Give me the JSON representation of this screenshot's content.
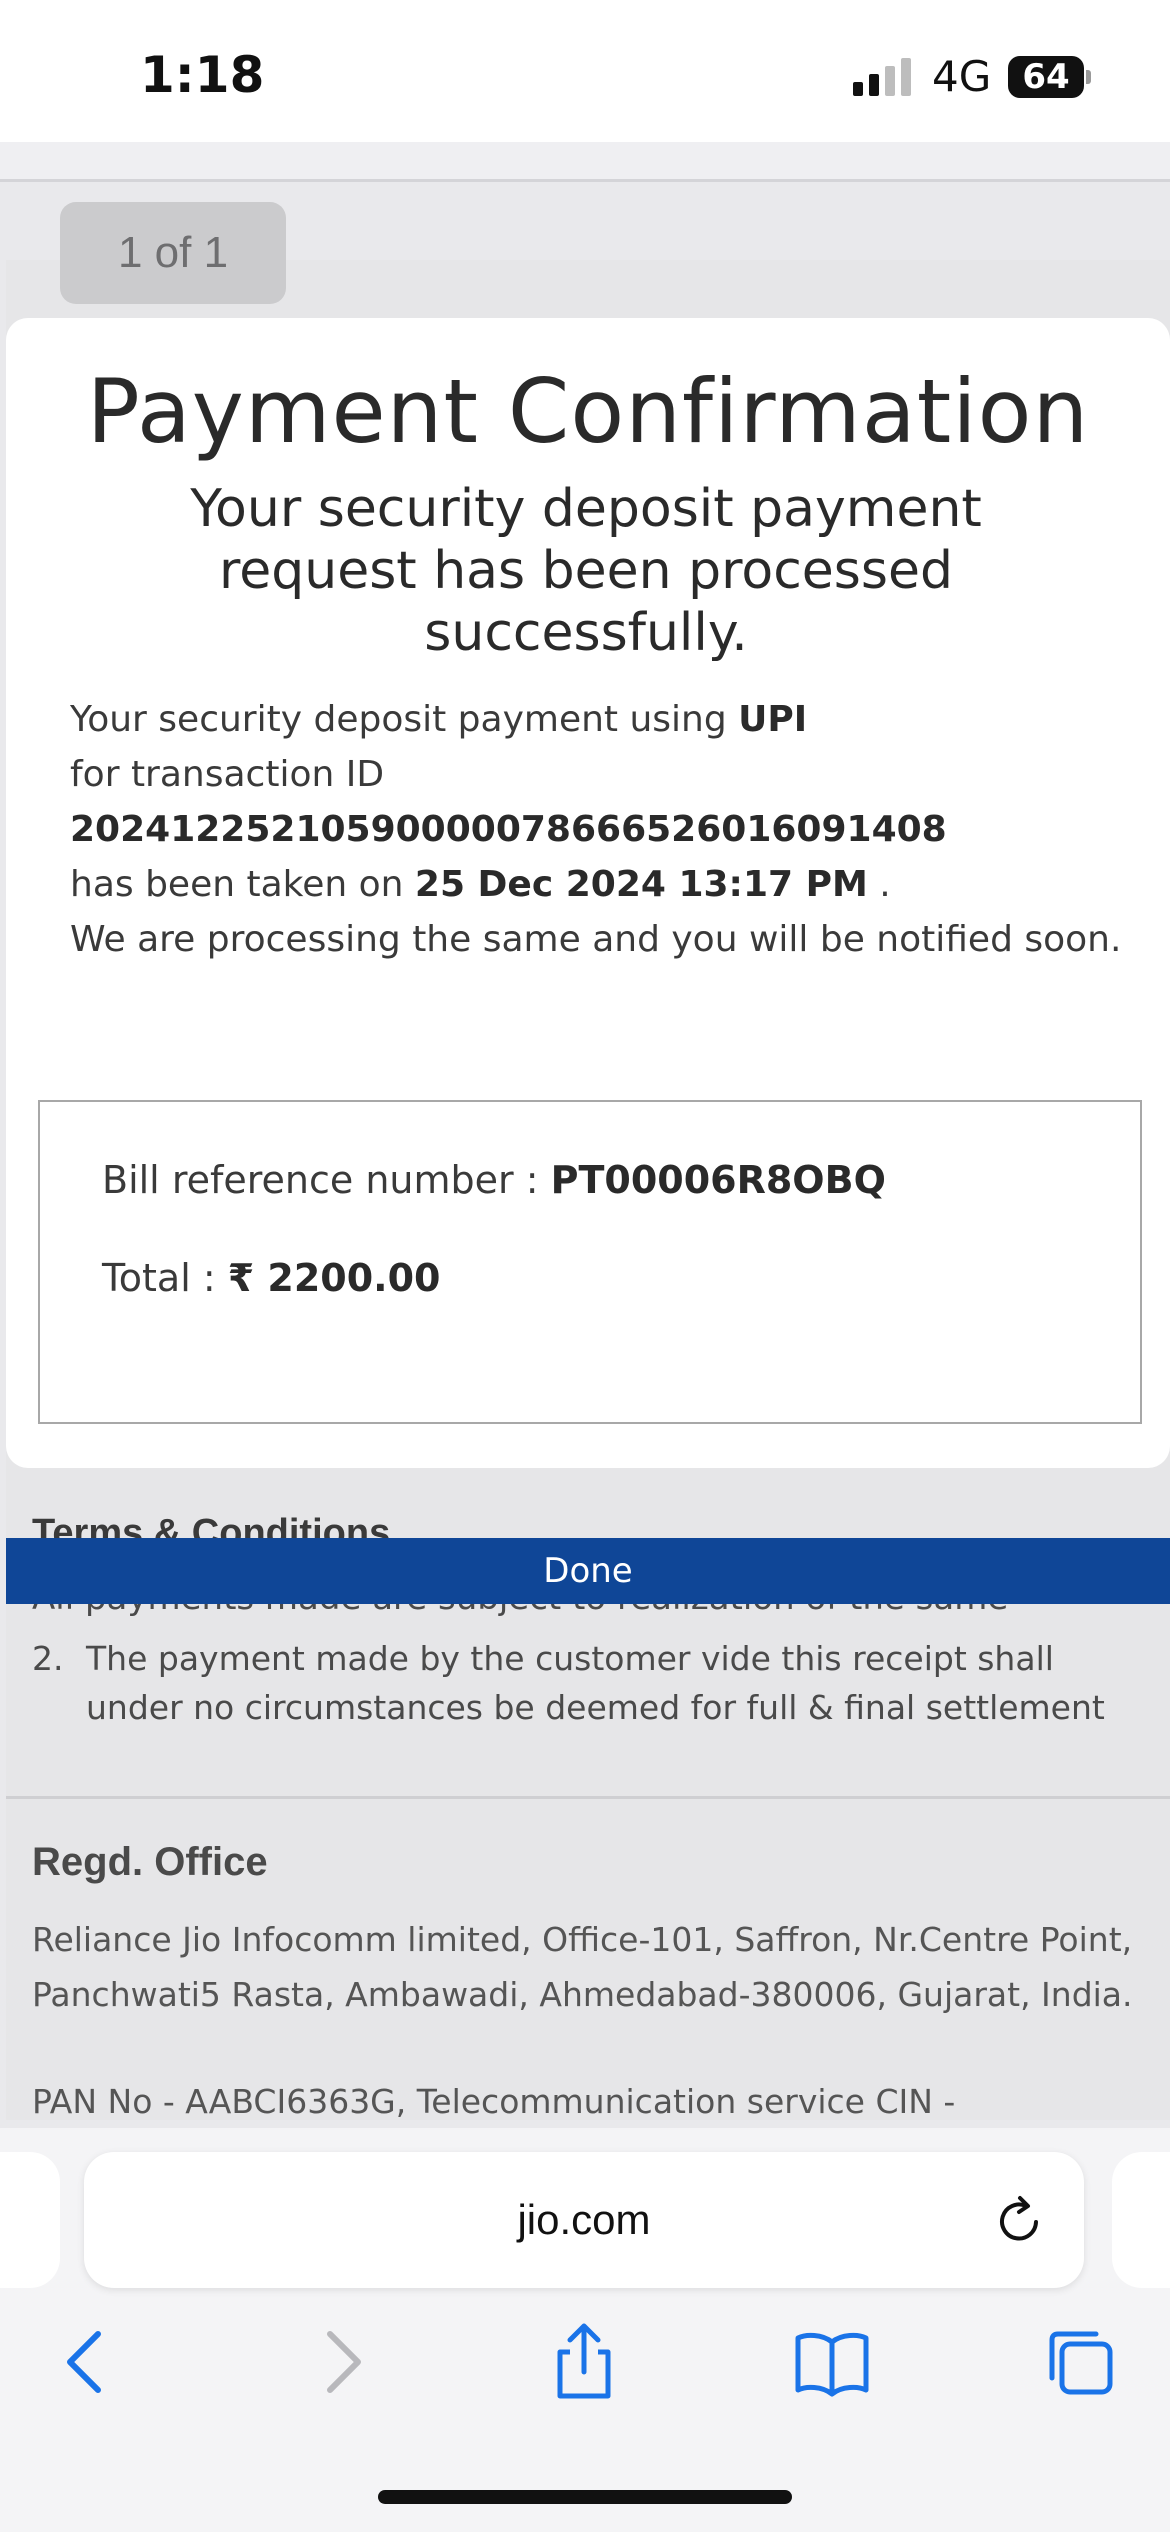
{
  "status_bar": {
    "time": "1:18",
    "network": "4G",
    "battery": "64"
  },
  "page_indicator": "1 of 1",
  "modal": {
    "title": "Payment Confirmation",
    "subtitle": "Your security deposit payment request has been processed successfully.",
    "body": {
      "line1_prefix": "Your security deposit payment using ",
      "payment_method": "UPI",
      "line2": "for transaction ID",
      "transaction_id": "20241225210590000078666526016091408",
      "taken_on_prefix": "has been taken on ",
      "date": "25 Dec 2024 13:17 PM",
      "taken_on_suffix": " .",
      "processing": "We are processing the same and you will be notified soon."
    },
    "bill": {
      "ref_label": "Bill reference number : ",
      "ref_value": "PT00006R8OBQ",
      "total_label": "Total : ",
      "total_value": "₹ 2200.00"
    }
  },
  "terms": {
    "heading": "Terms & Conditions",
    "item1": "All payments made are subject to realization of the same",
    "item2_num": "2.",
    "item2": "The payment made by the customer vide this receipt shall under no circumstances be deemed for full & final settlement"
  },
  "done_label": "Done",
  "office": {
    "heading": "Regd. Office",
    "address": "Reliance Jio Infocomm limited, Office-101, Saffron, Nr.Centre Point, Panchwati5 Rasta, Ambawadi, Ahmedabad-380006, Gujarat, India.",
    "pan": "PAN No - AABCI6363G, Telecommunication service CIN -"
  },
  "browser": {
    "url": "jio.com"
  },
  "colors": {
    "done_bar": "#0f4697",
    "safari_blue": "#1a73e8"
  }
}
